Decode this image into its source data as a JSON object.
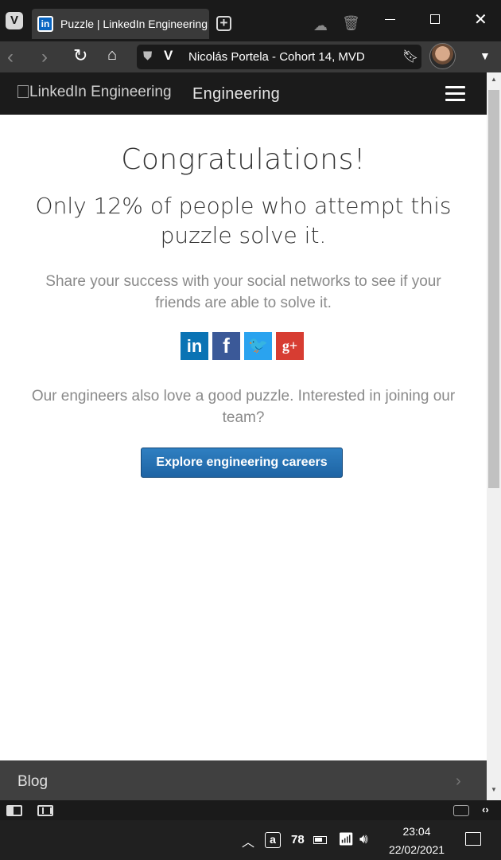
{
  "browser": {
    "tab": {
      "title": "Puzzle | LinkedIn Engineering",
      "favicon": "in"
    },
    "vivaldi_logo": "V",
    "new_tab_symbol": "+",
    "address": {
      "text": "Nicolás Portela - Cohort 14, MVD",
      "site_badge": "V"
    }
  },
  "site": {
    "logo_alt": "LinkedIn Engineering",
    "logo_text": "Engineering"
  },
  "main": {
    "title": "Congratulations!",
    "subtitle": "Only 12% of people who attempt this puzzle solve it.",
    "share_text": "Share your success with your social networks to see if your friends are able to solve it.",
    "social": {
      "linkedin": "in",
      "facebook": "f",
      "twitter": "🐦",
      "googleplus": "g+"
    },
    "join_text": "Our engineers also love a good puzzle. Interested in joining our team?",
    "cta_label": "Explore engineering careers"
  },
  "footer": {
    "blog_label": "Blog"
  },
  "taskbar": {
    "amazon_label": "a",
    "tray_number": "78",
    "time": "23:04",
    "date": "22/02/2021"
  },
  "colors": {
    "accent_button": "#2f7fc1",
    "linkedin": "#0a73b4",
    "facebook": "#3b5998",
    "twitter": "#2aa3ef",
    "googleplus": "#d73d32"
  }
}
